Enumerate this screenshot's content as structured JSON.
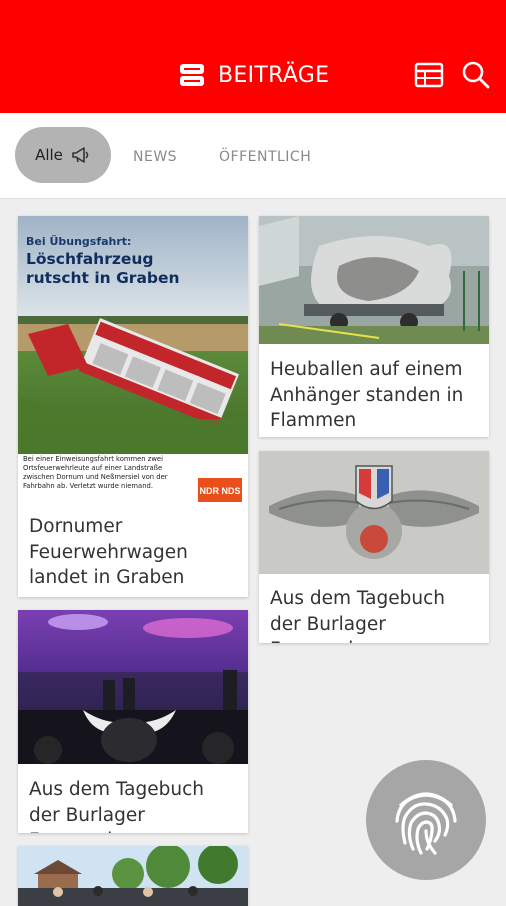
{
  "appbar": {
    "title": "BEITRÄGE",
    "bg": "#ff0000",
    "actions": [
      "table-icon",
      "search-icon"
    ]
  },
  "filters": {
    "active": "Alle",
    "tabs": [
      "NEWS",
      "ÖFFENTLICH"
    ]
  },
  "posts": [
    {
      "id": "loeschfahrzeug",
      "caption": "Dornumer Feuerwehrwagen landet in Graben",
      "image": {
        "kicker": "Bei Übungsfahrt:",
        "headline_line1": "Löschfahrzeug",
        "headline_line2": "rutscht in Graben",
        "subtext": "Bei einer Einweisungsfahrt kommen zwei Ortsfeuerwehrleute auf einer Landstraße zwischen Dornum und Neßmersiel von der Fahrbahn ab. Verletzt wurde niemand.",
        "logo": "NDR NDS"
      }
    },
    {
      "id": "heuballen",
      "caption": "Heuballen auf einem Anhänger standen in Flammen"
    },
    {
      "id": "tagebuch-badge",
      "caption": "Aus dem Tagebuch der Burlager Feuerwehr"
    },
    {
      "id": "tagebuch-concert",
      "caption": "Aus dem Tagebuch der Burlager Feuerwehr"
    },
    {
      "id": "outdoor-event",
      "caption": ""
    }
  ],
  "fab": {
    "icon": "fingerprint-icon"
  }
}
